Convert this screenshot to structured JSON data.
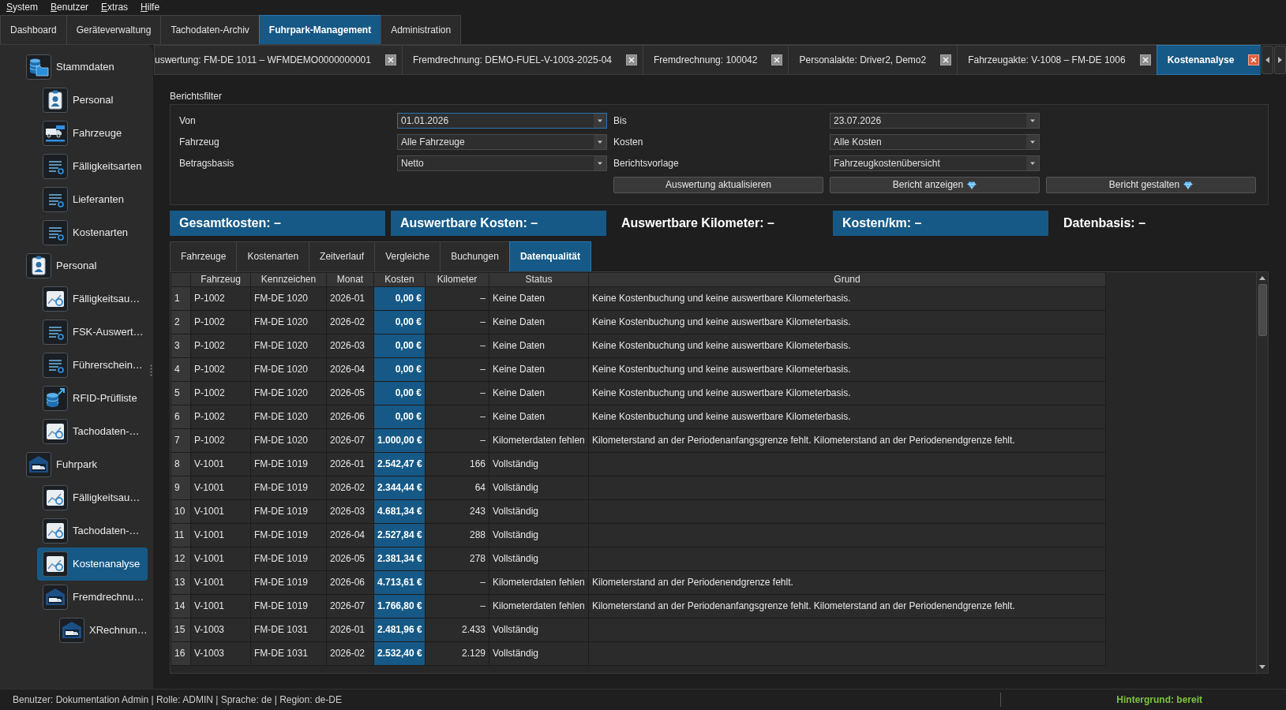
{
  "menu": [
    "System",
    "Benutzer",
    "Extras",
    "Hilfe"
  ],
  "main_tabs": [
    {
      "label": "Dashboard",
      "selected": false
    },
    {
      "label": "Geräteverwaltung",
      "selected": false
    },
    {
      "label": "Tachodaten-Archiv",
      "selected": false
    },
    {
      "label": "Fuhrpark-Management",
      "selected": true
    },
    {
      "label": "Administration",
      "selected": false
    }
  ],
  "sidebar": {
    "items": [
      {
        "label": "Stammdaten",
        "kind": "storage",
        "selected": false,
        "children": [
          {
            "label": "Personal",
            "kind": "badge",
            "selected": false
          },
          {
            "label": "Fahrzeuge",
            "kind": "vehicle",
            "selected": false
          },
          {
            "label": "Fälligkeitsarten",
            "kind": "list",
            "selected": false
          },
          {
            "label": "Lieferanten",
            "kind": "list",
            "selected": false
          },
          {
            "label": "Kostenarten",
            "kind": "list",
            "selected": false
          }
        ]
      },
      {
        "label": "Personal",
        "kind": "badge",
        "selected": false,
        "children": [
          {
            "label": "Fälligkeitsau…",
            "kind": "chart",
            "selected": false
          },
          {
            "label": "FSK-Auswert…",
            "kind": "list",
            "selected": false
          },
          {
            "label": "Führerschein…",
            "kind": "list",
            "selected": false
          },
          {
            "label": "RFID-Prüfliste",
            "kind": "export",
            "selected": false
          },
          {
            "label": "Tachodaten-…",
            "kind": "chart",
            "selected": false
          }
        ]
      },
      {
        "label": "Fuhrpark",
        "kind": "garage",
        "selected": false,
        "children": [
          {
            "label": "Fälligkeitsau…",
            "kind": "chart",
            "selected": false
          },
          {
            "label": "Tachodaten-…",
            "kind": "chart",
            "selected": false
          },
          {
            "label": "Kostenanalyse",
            "kind": "chart",
            "selected": true
          },
          {
            "label": "Fremdrechnu…",
            "kind": "garage",
            "selected": false,
            "children": [
              {
                "label": "XRechnun…",
                "kind": "garage",
                "selected": false
              }
            ]
          }
        ]
      }
    ]
  },
  "document_tabs": [
    {
      "label": "uswertung: FM-DE 1011 – WFMDEMO0000000001",
      "selected": false
    },
    {
      "label": "Fremdrechnung: DEMO-FUEL-V-1003-2025-04",
      "selected": false
    },
    {
      "label": "Fremdrechnung: 100042",
      "selected": false
    },
    {
      "label": "Personalakte: Driver2, Demo2",
      "selected": false
    },
    {
      "label": "Fahrzeugakte: V-1008 – FM-DE 1006",
      "selected": false
    },
    {
      "label": "Kostenanalyse",
      "selected": true
    }
  ],
  "report_filter": {
    "title": "Berichtsfilter",
    "fields": [
      {
        "label": "Von",
        "value": "01.01.2026",
        "focused": true
      },
      {
        "label": "Bis",
        "value": "23.07.2026",
        "focused": false
      },
      {
        "label": "Fahrzeug",
        "value": "Alle Fahrzeuge",
        "focused": false
      },
      {
        "label": "Kosten",
        "value": "Alle Kosten",
        "focused": false
      },
      {
        "label": "Betragsbasis",
        "value": "Netto",
        "focused": false
      },
      {
        "label": "Berichtsvorlage",
        "value": "Fahrzeugkostenübersicht",
        "focused": false
      }
    ],
    "buttons": [
      {
        "label": "Auswertung aktualisieren",
        "has_icon": false
      },
      {
        "label": "Bericht anzeigen",
        "has_icon": true
      },
      {
        "label": "Bericht gestalten",
        "has_icon": true
      }
    ]
  },
  "summary": [
    {
      "label": "Gesamtkosten: –",
      "highlighted": true
    },
    {
      "label": "Auswertbare Kosten: –",
      "highlighted": true
    },
    {
      "label": "Auswertbare Kilometer: –",
      "highlighted": false
    },
    {
      "label": "Kosten/km: –",
      "highlighted": true
    },
    {
      "label": "Datenbasis: –",
      "highlighted": false
    }
  ],
  "result_tabs": [
    {
      "label": "Fahrzeuge",
      "selected": false
    },
    {
      "label": "Kostenarten",
      "selected": false
    },
    {
      "label": "Zeitverlauf",
      "selected": false
    },
    {
      "label": "Vergleiche",
      "selected": false
    },
    {
      "label": "Buchungen",
      "selected": false
    },
    {
      "label": "Datenqualität",
      "selected": true
    }
  ],
  "table": {
    "columns": [
      {
        "label": "Fahrzeug",
        "kind": "text",
        "highlighted": false
      },
      {
        "label": "Kennzeichen",
        "kind": "text",
        "highlighted": false
      },
      {
        "label": "Monat",
        "kind": "text",
        "highlighted": false
      },
      {
        "label": "Kosten",
        "kind": "numeric",
        "highlighted": true
      },
      {
        "label": "Kilometer",
        "kind": "numeric",
        "highlighted": false
      },
      {
        "label": "Status",
        "kind": "text",
        "highlighted": false
      },
      {
        "label": "Grund",
        "kind": "text",
        "highlighted": false
      }
    ],
    "rows": [
      {
        "number": "1",
        "vehicle": "P-1002",
        "plate": "FM-DE 1020",
        "month": "2026-01",
        "cost": "0,00 €",
        "km": "–",
        "status": "Keine Daten",
        "reason": "Keine Kostenbuchung und keine auswertbare Kilometerbasis."
      },
      {
        "number": "2",
        "vehicle": "P-1002",
        "plate": "FM-DE 1020",
        "month": "2026-02",
        "cost": "0,00 €",
        "km": "–",
        "status": "Keine Daten",
        "reason": "Keine Kostenbuchung und keine auswertbare Kilometerbasis."
      },
      {
        "number": "3",
        "vehicle": "P-1002",
        "plate": "FM-DE 1020",
        "month": "2026-03",
        "cost": "0,00 €",
        "km": "–",
        "status": "Keine Daten",
        "reason": "Keine Kostenbuchung und keine auswertbare Kilometerbasis."
      },
      {
        "number": "4",
        "vehicle": "P-1002",
        "plate": "FM-DE 1020",
        "month": "2026-04",
        "cost": "0,00 €",
        "km": "–",
        "status": "Keine Daten",
        "reason": "Keine Kostenbuchung und keine auswertbare Kilometerbasis."
      },
      {
        "number": "5",
        "vehicle": "P-1002",
        "plate": "FM-DE 1020",
        "month": "2026-05",
        "cost": "0,00 €",
        "km": "–",
        "status": "Keine Daten",
        "reason": "Keine Kostenbuchung und keine auswertbare Kilometerbasis."
      },
      {
        "number": "6",
        "vehicle": "P-1002",
        "plate": "FM-DE 1020",
        "month": "2026-06",
        "cost": "0,00 €",
        "km": "–",
        "status": "Keine Daten",
        "reason": "Keine Kostenbuchung und keine auswertbare Kilometerbasis."
      },
      {
        "number": "7",
        "vehicle": "P-1002",
        "plate": "FM-DE 1020",
        "month": "2026-07",
        "cost": "1.000,00 €",
        "km": "–",
        "status": "Kilometerdaten fehlen",
        "reason": "Kilometerstand an der Periodenanfangsgrenze fehlt. Kilometerstand an der Periodenendgrenze fehlt."
      },
      {
        "number": "8",
        "vehicle": "V-1001",
        "plate": "FM-DE 1019",
        "month": "2026-01",
        "cost": "2.542,47 €",
        "km": "166",
        "status": "Vollständig"
      },
      {
        "number": "9",
        "vehicle": "V-1001",
        "plate": "FM-DE 1019",
        "month": "2026-02",
        "cost": "2.344,44 €",
        "km": "64",
        "status": "Vollständig"
      },
      {
        "number": "10",
        "vehicle": "V-1001",
        "plate": "FM-DE 1019",
        "month": "2026-03",
        "cost": "4.681,34 €",
        "km": "243",
        "status": "Vollständig"
      },
      {
        "number": "11",
        "vehicle": "V-1001",
        "plate": "FM-DE 1019",
        "month": "2026-04",
        "cost": "2.527,84 €",
        "km": "288",
        "status": "Vollständig"
      },
      {
        "number": "12",
        "vehicle": "V-1001",
        "plate": "FM-DE 1019",
        "month": "2026-05",
        "cost": "2.381,34 €",
        "km": "278",
        "status": "Vollständig"
      },
      {
        "number": "13",
        "vehicle": "V-1001",
        "plate": "FM-DE 1019",
        "month": "2026-06",
        "cost": "4.713,61 €",
        "km": "–",
        "status": "Kilometerdaten fehlen",
        "reason": "Kilometerstand an der Periodenendgrenze fehlt."
      },
      {
        "number": "14",
        "vehicle": "V-1001",
        "plate": "FM-DE 1019",
        "month": "2026-07",
        "cost": "1.766,80 €",
        "km": "–",
        "status": "Kilometerdaten fehlen",
        "reason": "Kilometerstand an der Periodenanfangsgrenze fehlt. Kilometerstand an der Periodenendgrenze fehlt."
      },
      {
        "number": "15",
        "vehicle": "V-1003",
        "plate": "FM-DE 1031",
        "month": "2026-01",
        "cost": "2.481,96 €",
        "km": "2.433",
        "status": "Vollständig"
      },
      {
        "number": "16",
        "vehicle": "V-1003",
        "plate": "FM-DE 1031",
        "month": "2026-02",
        "cost": "2.532,40 €",
        "km": "2.129",
        "status": "Vollständig"
      }
    ]
  },
  "status_bar": {
    "text": "Benutzer: Dokumentation Admin | Rolle: ADMIN | Sprache: de | Region: de-DE",
    "background_status": "Hintergrund: bereit"
  }
}
